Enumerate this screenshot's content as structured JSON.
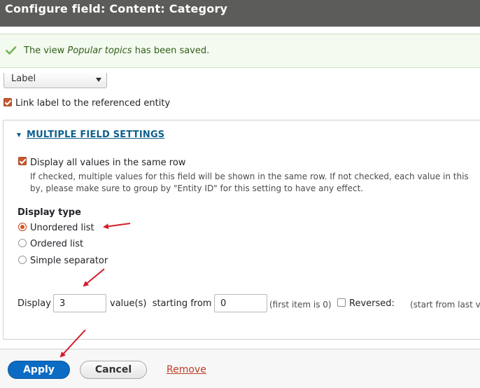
{
  "dialog": {
    "title": "Configure field: Content: Category"
  },
  "message": {
    "prefix": "The view ",
    "view_name": "Popular topics",
    "suffix": " has been saved."
  },
  "formatter": {
    "selected": "Label"
  },
  "link_label": {
    "label": "Link label to the referenced entity",
    "checked": true
  },
  "multiple": {
    "summary": "MULTIPLE FIELD SETTINGS",
    "same_row": {
      "label": "Display all values in the same row",
      "checked": true,
      "description_line1": "If checked, multiple values for this field will be shown in the same row. If not checked, each value in this",
      "description_line2": "by, please make sure to group by \"Entity ID\" for this setting to have any effect."
    },
    "display_type": {
      "legend": "Display type",
      "options": [
        "Unordered list",
        "Ordered list",
        "Simple separator"
      ],
      "selected": "Unordered list"
    },
    "delta": {
      "display_label": "Display",
      "limit_value": "3",
      "values_label": "value(s)  starting from",
      "offset_value": "0",
      "offset_hint": "(first item is 0)",
      "reversed_label": "Reversed:",
      "reversed_checked": false,
      "reversed_hint": "(start from last v"
    }
  },
  "actions": {
    "apply": "Apply",
    "cancel": "Cancel",
    "remove": "Remove"
  },
  "colors": {
    "accent": "#0c6bc2",
    "checkbox": "#c7582e",
    "annotation_arrow": "#d31c2a",
    "success": "#325e1c"
  }
}
